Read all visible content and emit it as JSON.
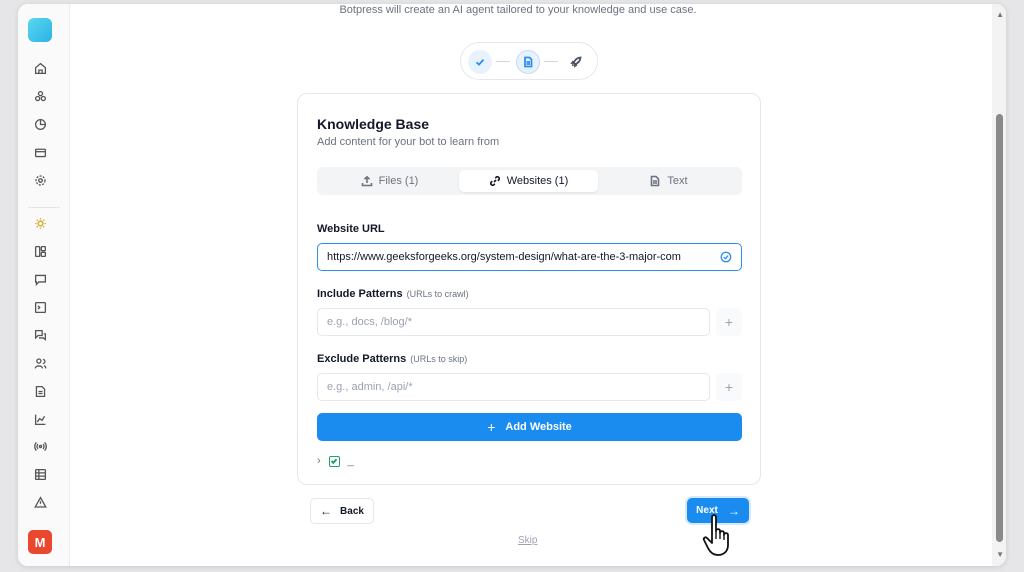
{
  "header": {
    "intro_text": "Botpress will create an AI agent tailored to your knowledge and use case."
  },
  "user": {
    "avatar_initial": "M"
  },
  "stepper": {
    "current_step": 2,
    "total_steps": 3
  },
  "card": {
    "title": "Knowledge Base",
    "subtitle": "Add content for your bot to learn from",
    "tabs": [
      {
        "label": "Files (1)",
        "icon": "upload-icon",
        "active": false
      },
      {
        "label": "Websites (1)",
        "icon": "link-icon",
        "active": true
      },
      {
        "label": "Text",
        "icon": "document-icon",
        "active": false
      }
    ],
    "website_url": {
      "label": "Website URL",
      "value": "https://www.geeksforgeeks.org/system-design/what-are-the-3-major-com"
    },
    "include": {
      "label": "Include Patterns",
      "hint": "(URLs to crawl)",
      "placeholder": "e.g., docs, /blog/*"
    },
    "exclude": {
      "label": "Exclude Patterns",
      "hint": "(URLs to skip)",
      "placeholder": "e.g., admin, /api/*"
    },
    "add_button": "Add Website",
    "tree_item_text": "_"
  },
  "footer": {
    "back_label": "Back",
    "next_label": "Next",
    "skip_label": "Skip"
  },
  "colors": {
    "accent": "#1a8cf0",
    "avatar": "#e9482f",
    "logo": "#2bb3e6"
  }
}
